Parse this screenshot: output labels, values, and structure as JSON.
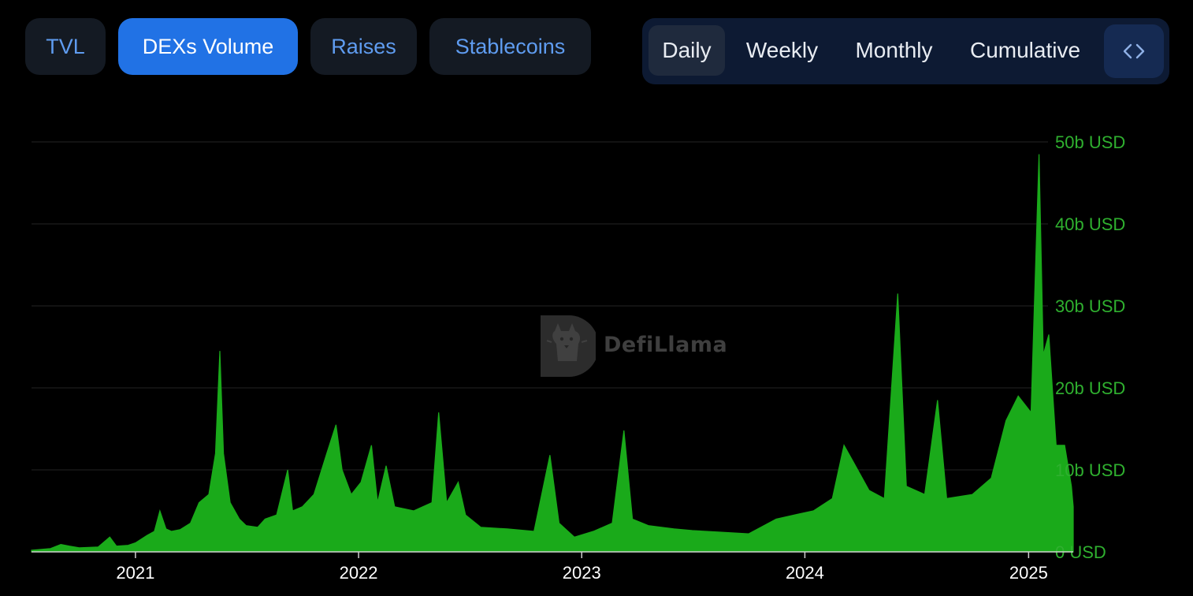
{
  "metric_tabs": [
    {
      "label": "TVL",
      "active": false
    },
    {
      "label": "DEXs Volume",
      "active": true
    },
    {
      "label": "Raises",
      "active": false
    },
    {
      "label": "Stablecoins",
      "active": false
    }
  ],
  "period_tabs": [
    {
      "label": "Daily",
      "active": true
    },
    {
      "label": "Weekly",
      "active": false
    },
    {
      "label": "Monthly",
      "active": false
    },
    {
      "label": "Cumulative",
      "active": false
    }
  ],
  "embed_icon": "code-brackets-icon",
  "watermark": {
    "text": "DefiLlama",
    "icon": "llama-logo-icon"
  },
  "colors": {
    "series": "#1aaa1a",
    "axis_labels": "#2fb02f",
    "active_tab": "#2172e5",
    "tab_text": "#5f9cf0"
  },
  "chart_data": {
    "type": "area",
    "title": "",
    "xlabel": "",
    "ylabel": "",
    "x_range": [
      "2020-07-15",
      "2025-03-15"
    ],
    "ylim": [
      0,
      50
    ],
    "y_unit": "b USD",
    "y_ticks": [
      {
        "value": 0,
        "label": "0 USD"
      },
      {
        "value": 10,
        "label": "10b USD"
      },
      {
        "value": 20,
        "label": "20b USD"
      },
      {
        "value": 30,
        "label": "30b USD"
      },
      {
        "value": 40,
        "label": "40b USD"
      },
      {
        "value": 50,
        "label": "50b USD"
      }
    ],
    "x_ticks": [
      {
        "date": "2021-01-01",
        "label": "2021"
      },
      {
        "date": "2022-01-01",
        "label": "2022"
      },
      {
        "date": "2023-01-01",
        "label": "2023"
      },
      {
        "date": "2024-01-01",
        "label": "2024"
      },
      {
        "date": "2025-01-01",
        "label": "2025"
      }
    ],
    "grid": true,
    "series": [
      {
        "name": "",
        "points": [
          [
            "2020-07-15",
            0.2
          ],
          [
            "2020-08-15",
            0.4
          ],
          [
            "2020-09-01",
            0.9
          ],
          [
            "2020-09-15",
            0.7
          ],
          [
            "2020-10-01",
            0.5
          ],
          [
            "2020-11-01",
            0.6
          ],
          [
            "2020-11-20",
            1.8
          ],
          [
            "2020-12-01",
            0.7
          ],
          [
            "2020-12-20",
            0.8
          ],
          [
            "2021-01-01",
            1.1
          ],
          [
            "2021-01-20",
            2.0
          ],
          [
            "2021-02-01",
            2.5
          ],
          [
            "2021-02-10",
            5.0
          ],
          [
            "2021-02-20",
            2.8
          ],
          [
            "2021-03-01",
            2.5
          ],
          [
            "2021-03-15",
            2.7
          ],
          [
            "2021-04-01",
            3.5
          ],
          [
            "2021-04-15",
            6.0
          ],
          [
            "2021-05-01",
            7.0
          ],
          [
            "2021-05-12",
            12.0
          ],
          [
            "2021-05-19",
            24.5
          ],
          [
            "2021-05-25",
            12.0
          ],
          [
            "2021-06-05",
            6.0
          ],
          [
            "2021-06-20",
            4.0
          ],
          [
            "2021-07-01",
            3.2
          ],
          [
            "2021-07-20",
            3.0
          ],
          [
            "2021-08-01",
            4.0
          ],
          [
            "2021-08-20",
            4.5
          ],
          [
            "2021-09-07",
            10.0
          ],
          [
            "2021-09-15",
            5.0
          ],
          [
            "2021-10-01",
            5.5
          ],
          [
            "2021-10-20",
            7.0
          ],
          [
            "2021-11-10",
            12.0
          ],
          [
            "2021-11-25",
            15.5
          ],
          [
            "2021-12-05",
            10.0
          ],
          [
            "2021-12-20",
            7.0
          ],
          [
            "2022-01-05",
            8.5
          ],
          [
            "2022-01-22",
            13.0
          ],
          [
            "2022-02-01",
            6.0
          ],
          [
            "2022-02-15",
            10.5
          ],
          [
            "2022-03-01",
            5.5
          ],
          [
            "2022-04-01",
            5.0
          ],
          [
            "2022-05-01",
            6.0
          ],
          [
            "2022-05-12",
            17.0
          ],
          [
            "2022-05-25",
            6.0
          ],
          [
            "2022-06-13",
            8.5
          ],
          [
            "2022-06-25",
            4.5
          ],
          [
            "2022-07-20",
            3.0
          ],
          [
            "2022-09-01",
            2.8
          ],
          [
            "2022-10-15",
            2.5
          ],
          [
            "2022-11-10",
            11.8
          ],
          [
            "2022-11-25",
            3.5
          ],
          [
            "2022-12-20",
            1.8
          ],
          [
            "2023-01-20",
            2.5
          ],
          [
            "2023-02-20",
            3.5
          ],
          [
            "2023-03-11",
            14.8
          ],
          [
            "2023-03-25",
            4.0
          ],
          [
            "2023-04-20",
            3.2
          ],
          [
            "2023-06-01",
            2.8
          ],
          [
            "2023-07-01",
            2.6
          ],
          [
            "2023-08-15",
            2.4
          ],
          [
            "2023-10-01",
            2.2
          ],
          [
            "2023-11-15",
            4.0
          ],
          [
            "2023-12-15",
            4.5
          ],
          [
            "2024-01-15",
            5.0
          ],
          [
            "2024-02-15",
            6.5
          ],
          [
            "2024-03-05",
            13.0
          ],
          [
            "2024-03-20",
            11.0
          ],
          [
            "2024-04-15",
            7.5
          ],
          [
            "2024-05-10",
            6.5
          ],
          [
            "2024-06-01",
            31.5
          ],
          [
            "2024-06-15",
            8.0
          ],
          [
            "2024-07-15",
            7.0
          ],
          [
            "2024-08-05",
            18.5
          ],
          [
            "2024-08-20",
            6.5
          ],
          [
            "2024-10-01",
            7.0
          ],
          [
            "2024-11-01",
            9.0
          ],
          [
            "2024-11-25",
            16.0
          ],
          [
            "2024-12-15",
            19.0
          ],
          [
            "2025-01-05",
            17.0
          ],
          [
            "2025-01-18",
            48.5
          ],
          [
            "2025-01-25",
            24.0
          ],
          [
            "2025-02-03",
            26.5
          ],
          [
            "2025-02-15",
            13.0
          ],
          [
            "2025-03-01",
            13.0
          ],
          [
            "2025-03-12",
            8.0
          ],
          [
            "2025-03-15",
            5.5
          ]
        ]
      }
    ]
  }
}
